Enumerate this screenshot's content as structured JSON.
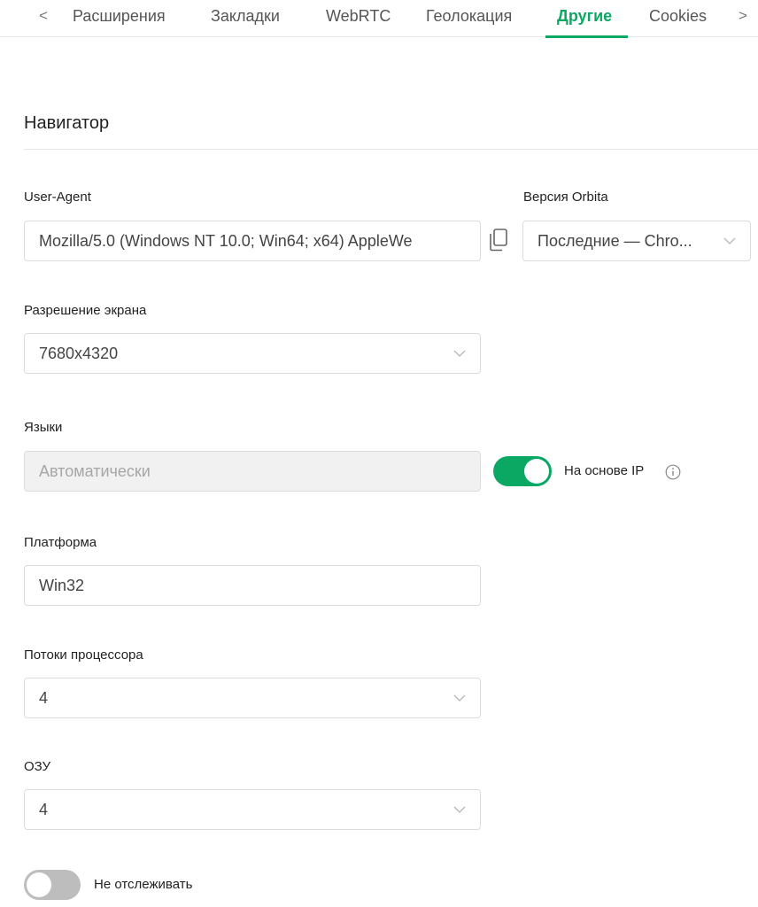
{
  "tabs": {
    "prev_arrow": "<",
    "next_arrow": ">",
    "items": [
      {
        "label": "Расширения"
      },
      {
        "label": "Закладки"
      },
      {
        "label": "WebRTC"
      },
      {
        "label": "Геолокация"
      },
      {
        "label": "Другие",
        "active": true
      },
      {
        "label": "Cookies"
      }
    ]
  },
  "section": {
    "title": "Навигатор"
  },
  "user_agent": {
    "label": "User-Agent",
    "value": "Mozilla/5.0 (Windows NT 10.0; Win64; x64) AppleWe"
  },
  "orbita_version": {
    "label": "Версия Orbita",
    "value": "Последние — Chro..."
  },
  "screen_resolution": {
    "label": "Разрешение экрана",
    "value": "7680x4320"
  },
  "languages": {
    "label": "Языки",
    "placeholder": "Автоматически",
    "toggle_label": "На основе IP",
    "toggle_on": true
  },
  "platform": {
    "label": "Платформа",
    "value": "Win32"
  },
  "cpu_threads": {
    "label": "Потоки процессора",
    "value": "4"
  },
  "ram": {
    "label": "ОЗУ",
    "value": "4"
  },
  "do_not_track": {
    "label": "Не отслеживать",
    "toggle_on": false
  },
  "colors": {
    "accent": "#0ba864",
    "toggle_off": "#bdbdbd",
    "border": "#dcdcdc",
    "disabled_bg": "#f1f1f1"
  }
}
